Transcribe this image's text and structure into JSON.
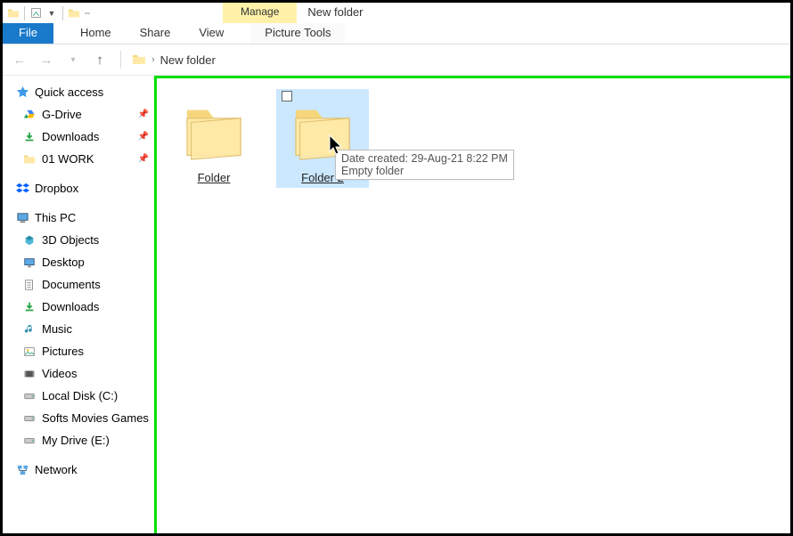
{
  "window_title": "New folder",
  "ribbon": {
    "context_group": "Manage",
    "tabs": {
      "file": "File",
      "home": "Home",
      "share": "Share",
      "view": "View",
      "picture_tools": "Picture Tools"
    }
  },
  "breadcrumb": {
    "current": "New folder"
  },
  "sidebar": {
    "quick_access": "Quick access",
    "qa_items": [
      {
        "label": "G-Drive",
        "icon": "gdrive"
      },
      {
        "label": "Downloads",
        "icon": "downloads"
      },
      {
        "label": "01 WORK",
        "icon": "folder"
      }
    ],
    "dropbox": "Dropbox",
    "this_pc": "This PC",
    "pc_items": [
      {
        "label": "3D Objects",
        "icon": "3d"
      },
      {
        "label": "Desktop",
        "icon": "desktop"
      },
      {
        "label": "Documents",
        "icon": "documents"
      },
      {
        "label": "Downloads",
        "icon": "downloads"
      },
      {
        "label": "Music",
        "icon": "music"
      },
      {
        "label": "Pictures",
        "icon": "pictures"
      },
      {
        "label": "Videos",
        "icon": "videos"
      },
      {
        "label": "Local Disk (C:)",
        "icon": "disk"
      },
      {
        "label": "Softs Movies Games",
        "icon": "disk"
      },
      {
        "label": "My Drive (E:)",
        "icon": "disk"
      }
    ],
    "network": "Network"
  },
  "items": [
    {
      "name": "Folder",
      "selected": false
    },
    {
      "name": "Folder 2",
      "selected": true
    }
  ],
  "tooltip": {
    "line1": "Date created: 29-Aug-21 8:22 PM",
    "line2": "Empty folder"
  }
}
